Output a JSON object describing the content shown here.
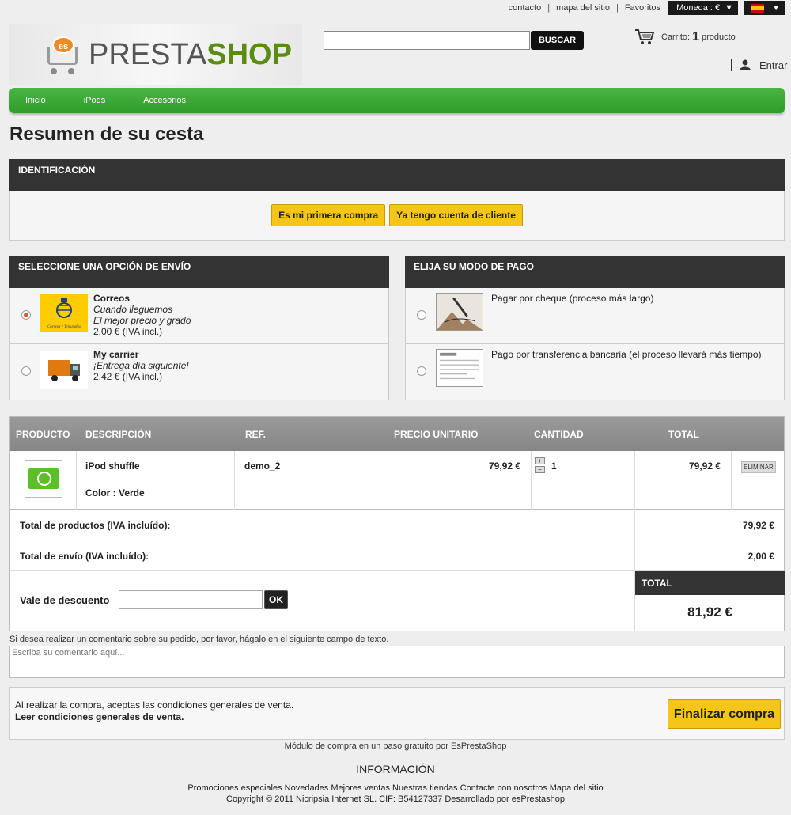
{
  "topbar": {
    "links": [
      "contacto",
      "mapa del sitio",
      "Favoritos"
    ],
    "currency": "Moneda : €"
  },
  "logo": {
    "badge": "es",
    "text_1": "PRESTA",
    "text_2": "SHOP"
  },
  "search": {
    "button": "BUSCAR",
    "value": ""
  },
  "cart": {
    "label": "Carrito:",
    "count": "1",
    "unit": "producto"
  },
  "login": {
    "label": "Entrar"
  },
  "nav": {
    "items": [
      "Inicio",
      "iPods",
      "Accesorios"
    ]
  },
  "page_title": "Resumen de su cesta",
  "identification": {
    "title": "IDENTIFICACIÓN",
    "first_purchase": "Es mi primera compra",
    "have_account": "Ya tengo cuenta de cliente"
  },
  "shipping": {
    "title": "SELECCIONE UNA OPCIÓN DE ENVÍO",
    "options": [
      {
        "name": "Correos",
        "line1": "Cuando lleguemos",
        "line2": "El mejor precio y grado",
        "price": "2,00 € (IVA incl.)",
        "selected": true,
        "img_text": "Correos y Telégrafos"
      },
      {
        "name": "My carrier",
        "line1": "¡Entrega día siguiente!",
        "line2": "",
        "price": "2,42 € (IVA incl.)",
        "selected": false
      }
    ]
  },
  "payment": {
    "title": "ELIJA SU MODO DE PAGO",
    "options": [
      {
        "label": "Pagar por cheque (proceso más largo)"
      },
      {
        "label": "Pago por transferencia bancaria (el proceso llevará más tiempo)"
      }
    ]
  },
  "cart_table": {
    "headers": [
      "PRODUCTO",
      "DESCRIPCIÓN",
      "REF.",
      "PRECIO UNITARIO",
      "CANTIDAD",
      "TOTAL"
    ],
    "rows": [
      {
        "name": "iPod shuffle",
        "attr": "Color : Verde",
        "ref": "demo_2",
        "unit_price": "79,92 €",
        "qty": "1",
        "total": "79,92 €",
        "delete": "ELIMINAR"
      }
    ],
    "qty_plus": "+",
    "qty_minus": "−"
  },
  "totals": {
    "products_label": "Total de productos (IVA incluído):",
    "products_value": "79,92 €",
    "shipping_label": "Total de envío (IVA incluído):",
    "shipping_value": "2,00 €",
    "discount_label": "Vale de descuento",
    "discount_ok": "OK",
    "total_label": "TOTAL",
    "total_value": "81,92 €"
  },
  "comment": {
    "label": "Si desea realizar un comentario sobre su pedido, por favor, hágalo en el siguiente campo de texto.",
    "placeholder": "Escriba su comentario aquí..."
  },
  "finish": {
    "terms": "Al realizar la compra, aceptas las condiciones generales de venta.",
    "terms_link": "Leer condiciones generales de venta.",
    "button": "Finalizar compra"
  },
  "footer": {
    "module": "Módulo de compra en un paso gratuito por EsPrestaShop",
    "info_title": "INFORMACIÓN",
    "links": [
      "Promociones especiales",
      "Novedades",
      "Mejores ventas",
      "Nuestras tiendas",
      "Contacte con nosotros",
      "Mapa del sitio"
    ],
    "copyright": "Copyright © 2011 Nicripsia Internet SL. CIF: B54127337 Desarrollado por esPrestashop"
  },
  "colors": {
    "accent": "#f5c518",
    "nav": "#3aa935",
    "header": "#333333",
    "selected_radio": "#e05a32"
  }
}
